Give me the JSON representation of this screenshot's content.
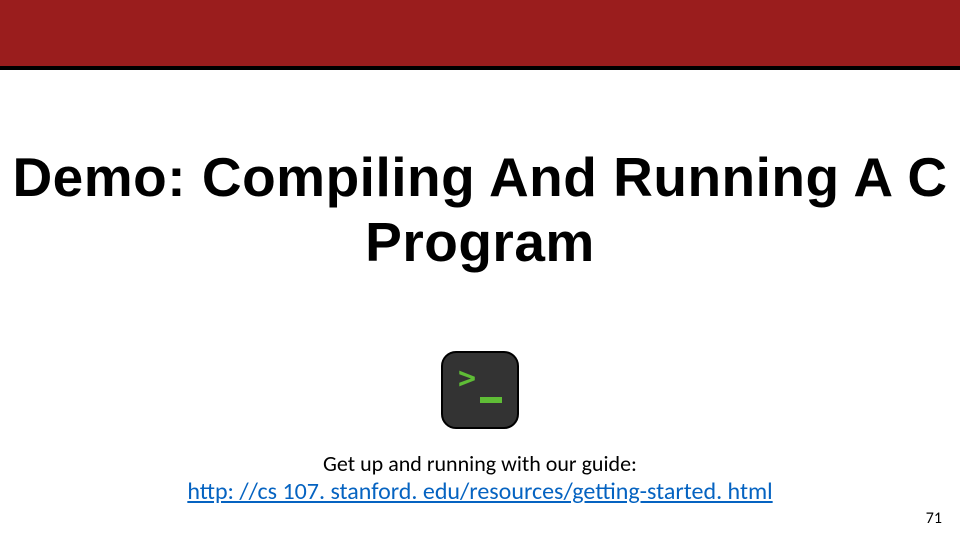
{
  "title": "Demo: Compiling And Running A C Program",
  "icon_name": "terminal-icon",
  "subtitle": "Get up and running with our guide:",
  "link_text": "http: //cs 107. stanford. edu/resources/getting-started. html",
  "page_number": "71",
  "colors": {
    "header_bg": "#9a1d1d",
    "link": "#0563c1"
  }
}
